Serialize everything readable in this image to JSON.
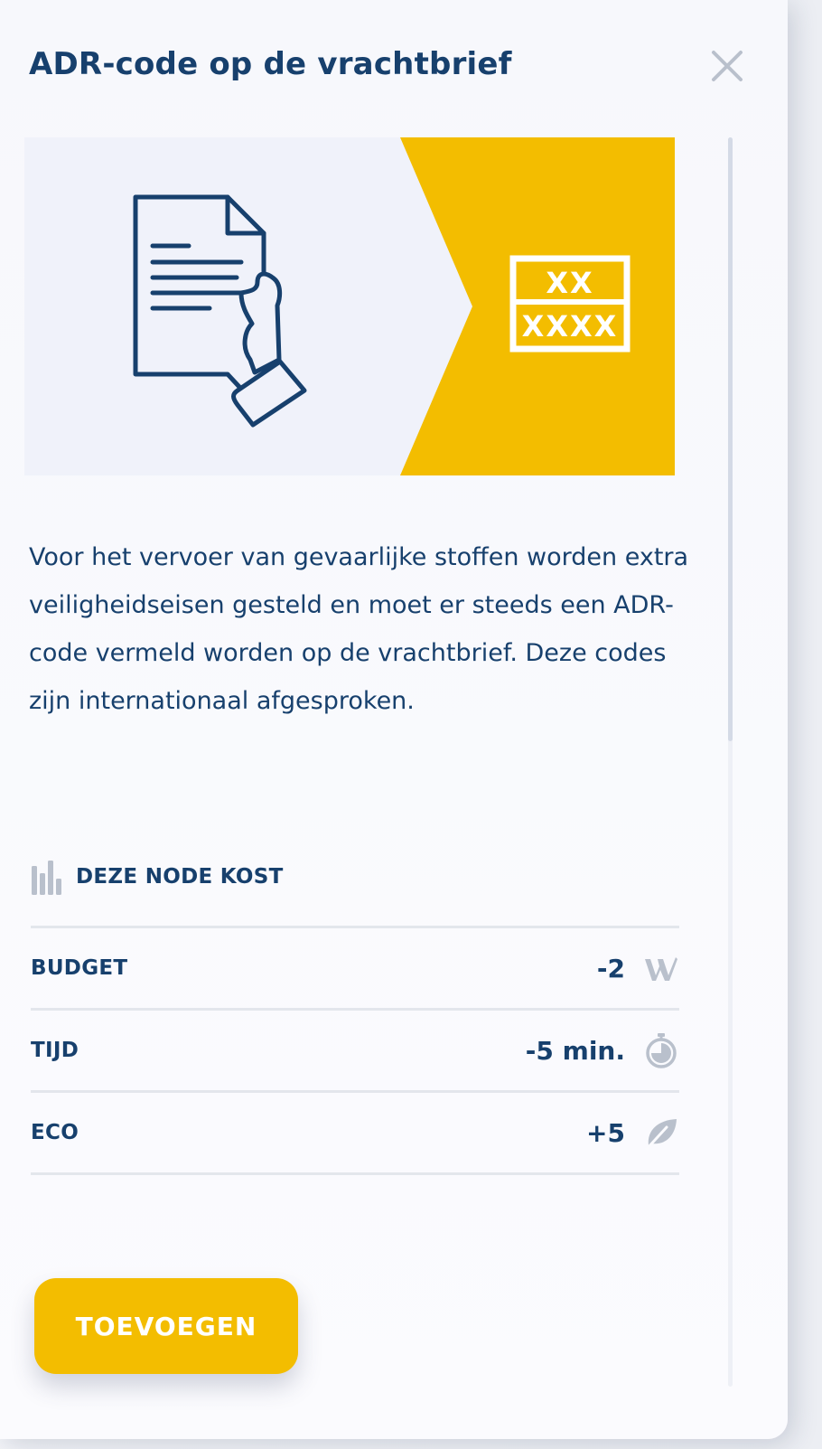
{
  "dialog": {
    "title": "ADR-code op de vrachtbrief",
    "description": "Voor het vervoer van gevaarlijke stoffen worden extra veiligheidseisen gesteld en moet er steeds een ADR-code vermeld worden op de vrachtbrief. Deze codes zijn internationaal afgesproken.",
    "close_icon": "close-icon"
  },
  "hero": {
    "document_icon": "document-in-hand-icon",
    "code_top": "XX",
    "code_bottom": "XXXX",
    "colors": {
      "left_bg": "#f0f2fa",
      "right_bg": "#f3bd00",
      "icon": "#17406d"
    }
  },
  "costs": {
    "heading": "DEZE NODE KOST",
    "heading_icon": "bar-chart-icon",
    "rows": [
      {
        "label": "BUDGET",
        "value": "-2",
        "icon": "budget-icon"
      },
      {
        "label": "TIJD",
        "value": "-5 min.",
        "icon": "stopwatch-icon"
      },
      {
        "label": "ECO",
        "value": "+5",
        "icon": "leaf-icon"
      }
    ]
  },
  "actions": {
    "add_label": "TOEVOEGEN"
  },
  "colors": {
    "primary_text": "#17406d",
    "accent": "#f3bd00",
    "muted_icon": "#b9c0cc",
    "divider": "#e3e6ec"
  }
}
